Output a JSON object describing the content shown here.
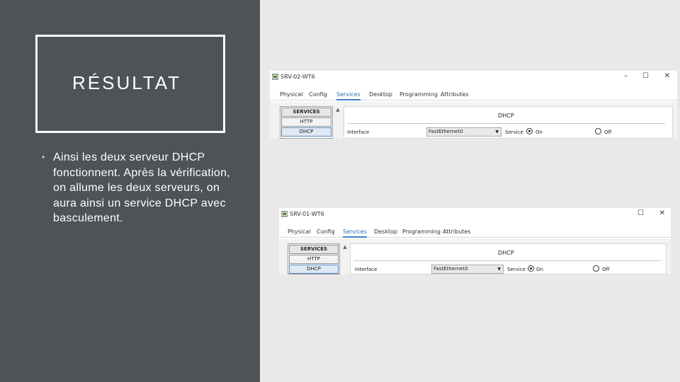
{
  "slide": {
    "title": "RÉSULTAT",
    "bullet": "Ainsi les deux serveur DHCP fonctionnent. Après la vérification, on allume les deux serveurs, on aura ainsi un service DHCP avec basculement.",
    "bullet_symbol": "•"
  },
  "colors": {
    "left_bg": "#4d5356",
    "right_bg": "#e9e9e9",
    "accent_tab": "#3b82c8"
  },
  "windows": [
    {
      "title": "SRV-02-WT6",
      "controls": {
        "minimize": "–",
        "maximize": "☐",
        "close": "✕"
      },
      "tabs": [
        "Physical",
        "Config",
        "Services",
        "Desktop",
        "Programming",
        "Attributes"
      ],
      "active_tab": "Services",
      "services": [
        "SERVICES",
        "HTTP",
        "DHCP"
      ],
      "selected_service": "DHCP",
      "panel_title": "DHCP",
      "interface_label": "Interface",
      "interface_value": "FastEthernet0",
      "service_label": "Service",
      "on_label": "On",
      "off_label": "Off",
      "service_state": "On"
    },
    {
      "title": "SRV-01-WT6",
      "controls": {
        "minimize": "–",
        "maximize": "☐",
        "close": "✕"
      },
      "tabs": [
        "Physical",
        "Config",
        "Services",
        "Desktop",
        "Programming",
        "Attributes"
      ],
      "active_tab": "Services",
      "services": [
        "SERVICES",
        "HTTP",
        "DHCP"
      ],
      "selected_service": "DHCP",
      "panel_title": "DHCP",
      "interface_label": "Interface",
      "interface_value": "FastEthernet0",
      "service_label": "Service",
      "on_label": "On",
      "off_label": "Off",
      "service_state": "On"
    }
  ]
}
